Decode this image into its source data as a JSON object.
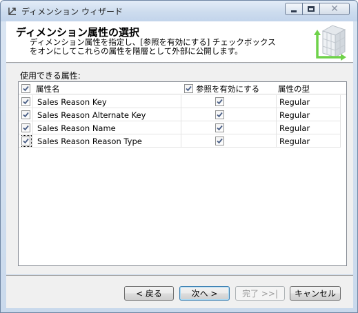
{
  "window": {
    "title": "ディメンション ウィザード",
    "controls": {
      "minimize": "minimize",
      "maximize": "maximize",
      "close": "x"
    }
  },
  "header": {
    "title": "ディメンション属性の選択",
    "description_line1": "ディメンション属性を指定し、[参照を有効にする] チェックボックス",
    "description_line2": "をオンにしてこれらの属性を階層として外部に公開します。"
  },
  "attributes": {
    "label": "使用できる属性:",
    "columns": {
      "name": "属性名",
      "browse": "参照を有効にする",
      "type": "属性の型"
    },
    "header_checked": {
      "name": true,
      "browse": true
    },
    "rows": [
      {
        "name": "Sales Reason Key",
        "checked": true,
        "browse": true,
        "type": "Regular"
      },
      {
        "name": "Sales Reason Alternate Key",
        "checked": true,
        "browse": true,
        "type": "Regular"
      },
      {
        "name": "Sales Reason Name",
        "checked": true,
        "browse": true,
        "type": "Regular"
      },
      {
        "name": "Sales Reason Reason Type",
        "checked": true,
        "browse": true,
        "type": "Regular"
      }
    ]
  },
  "buttons": {
    "back": "< 戻る",
    "next": "次へ >",
    "finish": "完了 >>|",
    "cancel": "キャンセル"
  }
}
